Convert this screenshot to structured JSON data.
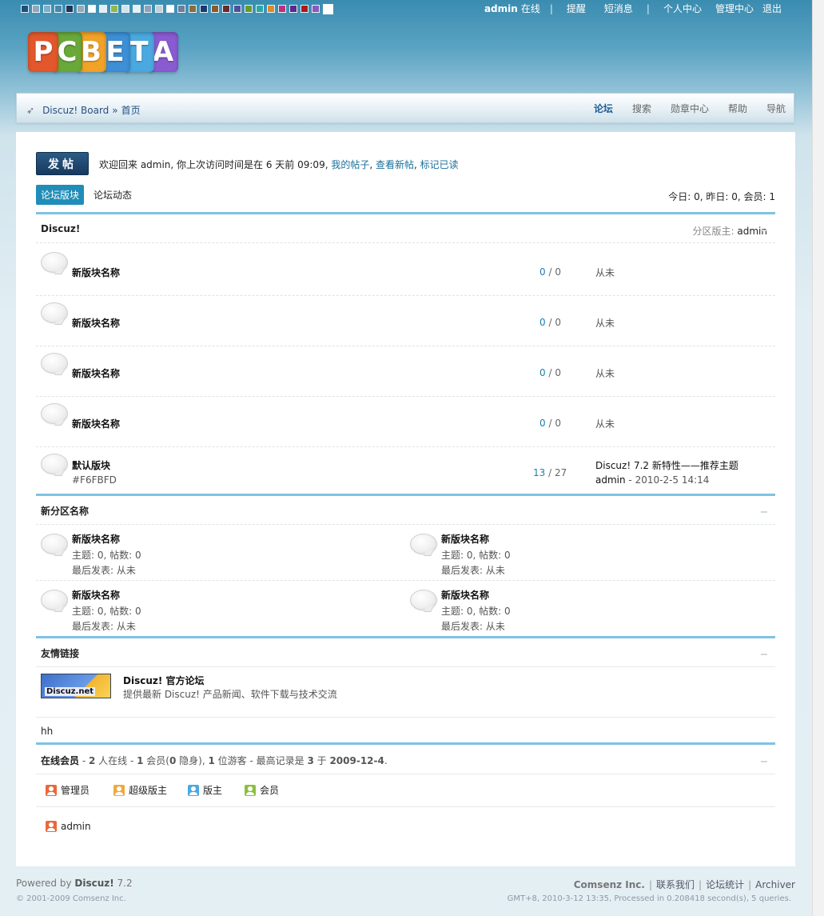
{
  "swatches": [
    "#1f4e79",
    "#94a7b8",
    "#7fb0c8",
    "#4a87a8",
    "#1d3557",
    "#9aa9b5",
    "#ffffff",
    "#e6eef2",
    "#93b84a",
    "#d5e3ea",
    "#e8f0f3",
    "#8fa3b5",
    "#c4d0d8",
    "#ffffff",
    "#6d7f9a",
    "#8a6d3b",
    "#1b3a6b",
    "#8a5a2b",
    "#6a2a2a",
    "#4f4f9a",
    "#6a9a2a",
    "#2aa8a8",
    "#e08a2a",
    "#c0307a",
    "#5a2a8a",
    "#b01818",
    "#8a5ab8",
    "#ffffff"
  ],
  "topnav": {
    "user": "admin",
    "status": "在线",
    "remind": "提醒",
    "pm": "短消息",
    "ucenter": "个人中心",
    "admincp": "管理中心",
    "logout": "退出"
  },
  "logo": {
    "letters": [
      "P",
      "C",
      "B",
      "E",
      "T",
      "A"
    ],
    "colors": [
      "#e2572b",
      "#6aa83a",
      "#f2a227",
      "#3d8fd6",
      "#4aa9e0",
      "#8a5ad0"
    ]
  },
  "breadcrumb": {
    "root": "Discuz! Board",
    "sep": "»",
    "current": "首页"
  },
  "menu": {
    "forum": "论坛",
    "search": "搜索",
    "medal": "勋章中心",
    "help": "帮助",
    "nav": "导航"
  },
  "post_button": "发帖",
  "welcome": {
    "prefix": "欢迎回来  admin, 你上次访问时间是在  6 天前 09:09, ",
    "my_posts": "我的帖子",
    "sep1": ", ",
    "new_posts": "查看新帖",
    "sep2": ", ",
    "mark_read": "标记已读"
  },
  "tabs": {
    "active": "论坛版块",
    "other": "论坛动态"
  },
  "stats": "今日: 0, 昨日: 0, 会员: 1",
  "section1": {
    "title": "Discuz!",
    "mod_label": "分区版主: ",
    "mod_name": "admin",
    "forums": [
      {
        "name": "新版块名称",
        "threads": "0",
        "slash": " / ",
        "posts": "0",
        "last": "从未"
      },
      {
        "name": "新版块名称",
        "threads": "0",
        "slash": " / ",
        "posts": "0",
        "last": "从未"
      },
      {
        "name": "新版块名称",
        "threads": "0",
        "slash": " / ",
        "posts": "0",
        "last": "从未"
      },
      {
        "name": "新版块名称",
        "threads": "0",
        "slash": " / ",
        "posts": "0",
        "last": "从未"
      },
      {
        "name": "默认版块",
        "desc": "#F6FBFD",
        "threads": "13",
        "slash": " / ",
        "posts": "27",
        "last": "Discuz! 7.2 新特性——推荐主题",
        "last_user": "admin",
        "last_time": " - 2010-2-5 14:14"
      }
    ]
  },
  "section2": {
    "title": "新分区名称",
    "forums": [
      {
        "name": "新版块名称",
        "stat": "主题: 0, 帖数: 0",
        "last": "最后发表: 从未"
      },
      {
        "name": "新版块名称",
        "stat": "主题: 0, 帖数: 0",
        "last": "最后发表: 从未"
      },
      {
        "name": "新版块名称",
        "stat": "主题: 0, 帖数: 0",
        "last": "最后发表: 从未"
      },
      {
        "name": "新版块名称",
        "stat": "主题: 0, 帖数: 0",
        "last": "最后发表: 从未"
      }
    ]
  },
  "links": {
    "title": "友情链接",
    "logo_text": "Discuz.net",
    "name": "Discuz! 官方论坛",
    "desc": "提供最新  Discuz! 产品新闻、软件下载与技术交流",
    "text_link": "hh"
  },
  "online": {
    "title": "在线会员",
    "summary_a": " - ",
    "total": "2",
    "summary_b": " 人在线  - ",
    "members": "1",
    "summary_c": " 会员(",
    "hidden": "0",
    "summary_d": " 隐身), ",
    "guests": "1",
    "summary_e": " 位游客  - 最高记录是  ",
    "record": "3",
    "summary_f": " 于  ",
    "record_date": "2009-12-4",
    "summary_g": ".",
    "legend": [
      {
        "label": "管理员",
        "color": "#e8693a"
      },
      {
        "label": "超级版主",
        "color": "#f2a83a"
      },
      {
        "label": "版主",
        "color": "#4aa8e0"
      },
      {
        "label": "会员",
        "color": "#8ac23a"
      }
    ],
    "users": [
      {
        "name": "admin",
        "color": "#e8693a"
      }
    ]
  },
  "footer": {
    "powered": "Powered by ",
    "product": "Discuz!",
    "version": " 7.2",
    "copyright": "© 2001-2009 Comsenz Inc.",
    "company": "Comsenz Inc.",
    "contact": "联系我们",
    "stats": "论坛统计",
    "archiver": "Archiver",
    "gmt": "GMT+8, 2010-3-12 13:35, Processed in 0.208418 second(s), 5 queries."
  }
}
